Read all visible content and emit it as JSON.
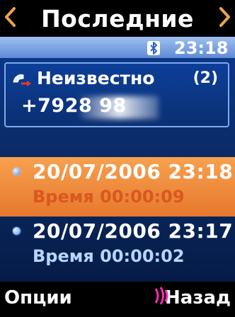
{
  "header": {
    "title": "Последние"
  },
  "status_bar": {
    "time": "23:18",
    "bluetooth_icon": "bluetooth-icon"
  },
  "contact": {
    "name": "Неизвестно",
    "count": "(2)",
    "number": "+7928    98",
    "icon": "phone-forward-icon"
  },
  "entries": [
    {
      "datetime": "20/07/2006 23:18",
      "duration": "Время 00:00:09"
    },
    {
      "datetime": "20/07/2006 23:17",
      "duration": "Время 00:00:02"
    }
  ],
  "softkeys": {
    "left": "Опции",
    "right": "Назад"
  },
  "colors": {
    "accent_orange": "#f7a14f",
    "screen_blue": "#0b3a8e",
    "status_light_blue": "#9fc0ef"
  }
}
